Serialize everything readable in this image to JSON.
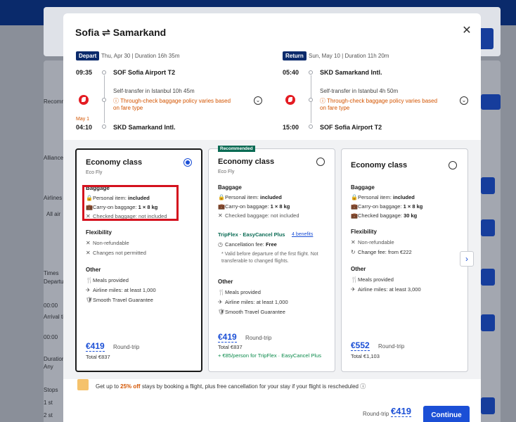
{
  "modal": {
    "title": "Sofia ⇌ Samarkand",
    "close": "✕"
  },
  "depart": {
    "badge": "Depart",
    "date_duration": "Thu, Apr 30  |  Duration 16h 35m",
    "dep_time": "09:35",
    "dep_airport": "SOF Sofia Airport T2",
    "transfer": "Self-transfer in Istanbul  10h 45m",
    "warning": "Through-check baggage policy varies based on fare type",
    "arr_day": "May 1",
    "arr_time": "04:10",
    "arr_airport": "SKD Samarkand Intl."
  },
  "return": {
    "badge": "Return",
    "date_duration": "Sun, May 10  |  Duration 11h 20m",
    "dep_time": "05:40",
    "dep_airport": "SKD Samarkand Intl.",
    "transfer": "Self-transfer in Istanbul  4h 50m",
    "warning": "Through-check baggage policy varies based on fare type",
    "arr_time": "15:00",
    "arr_airport": "SOF Sofia Airport T2"
  },
  "fares": [
    {
      "title": "Economy class",
      "subtitle": "Eco Fly",
      "baggage_heading": "Baggage",
      "personal": "Personal item: ",
      "personal_val": "included",
      "carryon": "Carry-on baggage: ",
      "carryon_val": "1 × 8 kg",
      "checked": "Checked baggage: not included",
      "flex_heading": "Flexibility",
      "flex1": "Non-refundable",
      "flex2": "Changes not permitted",
      "other_heading": "Other",
      "other1": "Meals provided",
      "other2": "Airline miles: at least 1,000",
      "other3": "Smooth Travel Guarantee",
      "price": "€419",
      "price_note": "Round-trip",
      "total": "Total €837"
    },
    {
      "badge": "Recommended",
      "title": "Economy class",
      "subtitle": "Eco Fly",
      "baggage_heading": "Baggage",
      "personal": "Personal item: ",
      "personal_val": "included",
      "carryon": "Carry-on baggage: ",
      "carryon_val": "1 × 8 kg",
      "checked": "Checked baggage: not included",
      "tripflex": "TripFlex · EasyCancel Plus",
      "benefits": "4 benefits",
      "cancel_fee": "Cancellation fee: ",
      "cancel_val": "Free",
      "note": "* Valid before departure of the first flight. Not transferable to changed flights.",
      "other_heading": "Other",
      "other1": "Meals provided",
      "other2": "Airline miles: at least 1,000",
      "other3": "Smooth Travel Guarantee",
      "price": "€419",
      "price_note": "Round-trip",
      "total": "Total €837",
      "addon": "+ €85/person for TripFlex · EasyCancel Plus"
    },
    {
      "title": "Economy class",
      "baggage_heading": "Baggage",
      "personal": "Personal item: ",
      "personal_val": "included",
      "carryon": "Carry-on baggage: ",
      "carryon_val": "1 × 8 kg",
      "checked": "Checked baggage: ",
      "checked_val": "30 kg",
      "flex_heading": "Flexibility",
      "flex1": "Non-refundable",
      "flex2": "Change fee: from €222",
      "other_heading": "Other",
      "other1": "Meals provided",
      "other2": "Airline miles: at least 3,000",
      "price": "€552",
      "price_note": "Round-trip",
      "total": "Total €1,103"
    }
  ],
  "promo": {
    "pre": "Get up to ",
    "pct": "25% off",
    "post": " stays by booking a flight, plus free cancellation for your stay if your flight is rescheduled"
  },
  "footer": {
    "note": "Round-trip",
    "price": "€419",
    "continue": "Continue"
  },
  "background": {
    "recommended": "Recomm",
    "alliance": "Alliance",
    "airlines": "Airlines",
    "times": "Times",
    "departure": "Departu",
    "arrival": "Arrival ti",
    "t1": "00:00",
    "t2": "00:00",
    "duration": "Duration",
    "any": "Any",
    "stops": "Stops",
    "s1": "1 st",
    "s2": "2 st",
    "all_air": "All air"
  }
}
